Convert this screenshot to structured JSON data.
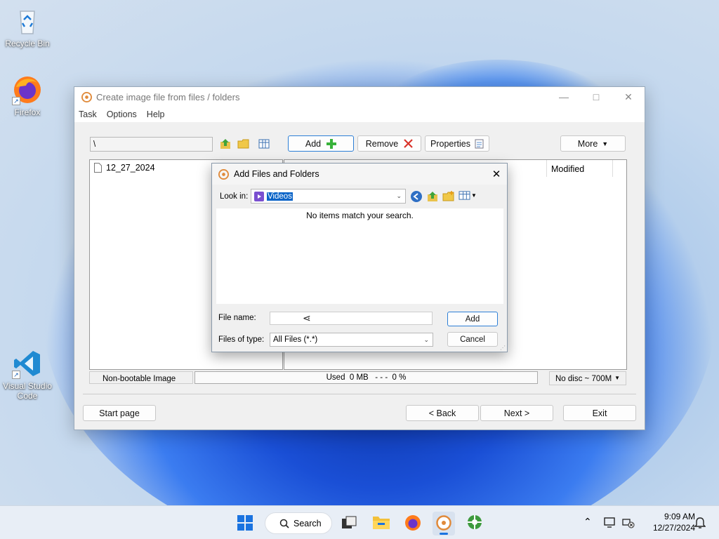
{
  "desktop": {
    "icons": [
      {
        "label": "Recycle Bin",
        "icon": "recycle-bin-icon"
      },
      {
        "label": "Firefox",
        "icon": "firefox-icon"
      },
      {
        "label": "Visual Studio Code",
        "icon": "vscode-icon"
      }
    ]
  },
  "window": {
    "title": "Create image file from files / folders",
    "menu": [
      "Task",
      "Options",
      "Help"
    ],
    "path_value": "\\",
    "toolbar": {
      "add_label": "Add",
      "remove_label": "Remove",
      "properties_label": "Properties",
      "more_label": "More"
    },
    "tree_item": "12_27_2024",
    "column_modified": "Modified",
    "status": {
      "boot_type": "Non-bootable Image",
      "used": "Used  0 MB   - - -  0 %",
      "disc": "No disc ~ 700M"
    },
    "footer": {
      "start_page": "Start page",
      "back": "< Back",
      "next": "Next >",
      "exit": "Exit"
    }
  },
  "dialog": {
    "title": "Add Files and Folders",
    "look_in_label": "Look in:",
    "look_in_value": "Videos",
    "empty_message": "No items match your search.",
    "file_name_label": "File name:",
    "file_name_value": "",
    "files_of_type_label": "Files of type:",
    "files_of_type_value": "All Files (*.*)",
    "add_button": "Add",
    "cancel_button": "Cancel"
  },
  "taskbar": {
    "search_label": "Search",
    "time": "9:09 AM",
    "date": "12/27/2024"
  },
  "colors": {
    "accent": "#2d7fd6",
    "selection": "#0a64c8",
    "taskbar": "#e8eef6"
  }
}
